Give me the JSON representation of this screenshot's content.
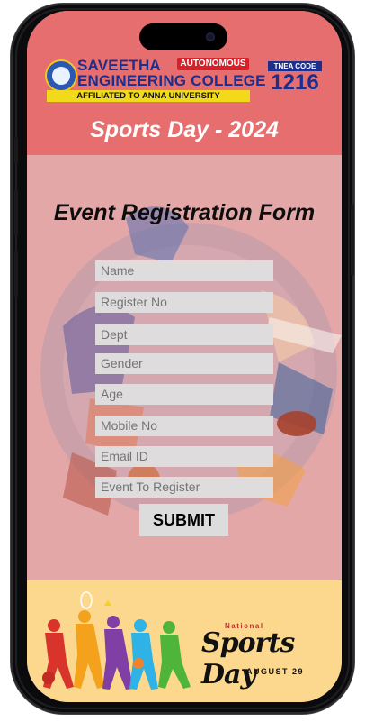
{
  "header": {
    "college_line1": "SAVEETHA",
    "college_line2": "ENGINEERING COLLEGE",
    "autonomous": "AUTONOMOUS",
    "affiliation": "AFFILIATED TO ANNA UNIVERSITY",
    "tnea_label": "TNEA CODE",
    "tnea_code": "1216",
    "event_title": "Sports Day - 2024"
  },
  "form": {
    "title": "Event Registration Form",
    "fields": [
      {
        "placeholder": "Name"
      },
      {
        "placeholder": "Register No"
      },
      {
        "placeholder": "Dept"
      },
      {
        "placeholder": "Gender"
      },
      {
        "placeholder": "Age"
      },
      {
        "placeholder": "Mobile No"
      },
      {
        "placeholder": "Email ID"
      },
      {
        "placeholder": "Event To Register"
      }
    ],
    "submit_label": "SUBMIT"
  },
  "footer": {
    "national": "National",
    "sports_day": "Sports Day",
    "date": "AUGUST 29"
  },
  "colors": {
    "header_bg": "#e76e6e",
    "content_bg": "#e3a7a8",
    "footer_bg": "#fbd88e",
    "brand_blue": "#1d2f8c",
    "brand_red": "#d62128",
    "brand_yellow": "#f2da1b"
  }
}
